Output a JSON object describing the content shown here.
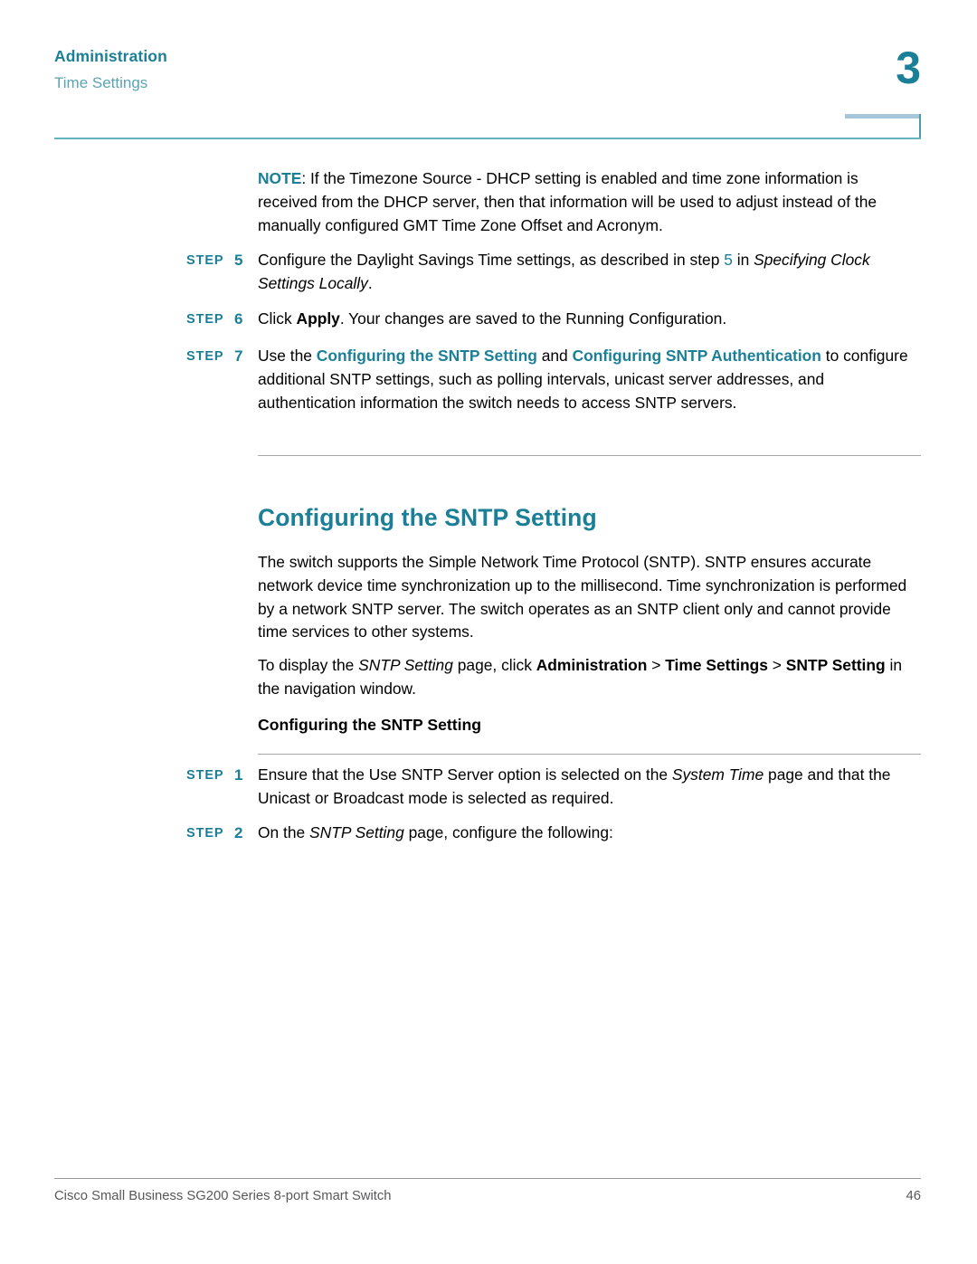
{
  "header": {
    "chapter_title": "Administration",
    "section_title": "Time Settings",
    "chapter_number": "3"
  },
  "note": {
    "label": "NOTE",
    "text": ": If the Timezone Source - DHCP setting is enabled and time zone information is received from the DHCP server, then that information will be used to adjust instead of the manually configured GMT Time Zone Offset and Acronym."
  },
  "steps_group_one": [
    {
      "label": "STEP",
      "number": "5",
      "parts": [
        {
          "text": "Configure the Daylight Savings Time settings, as described in step ",
          "style": "plain"
        },
        {
          "text": "5",
          "style": "teal"
        },
        {
          "text": " in ",
          "style": "plain"
        },
        {
          "text": "Specifying Clock Settings Locally",
          "style": "italic"
        },
        {
          "text": ".",
          "style": "plain"
        }
      ]
    },
    {
      "label": "STEP",
      "number": "6",
      "parts": [
        {
          "text": "Click ",
          "style": "plain"
        },
        {
          "text": "Apply",
          "style": "bold"
        },
        {
          "text": ". Your changes are saved to the Running Configuration.",
          "style": "plain"
        }
      ]
    },
    {
      "label": "STEP",
      "number": "7",
      "parts": [
        {
          "text": "Use the ",
          "style": "plain"
        },
        {
          "text": "Configuring the SNTP Setting",
          "style": "teal-bold"
        },
        {
          "text": " and ",
          "style": "plain"
        },
        {
          "text": "Configuring SNTP Authentication",
          "style": "teal-bold"
        },
        {
          "text": " to configure additional SNTP settings, such as polling intervals, unicast server addresses, and authentication information the switch needs to access SNTP servers.",
          "style": "plain"
        }
      ]
    }
  ],
  "section": {
    "heading": "Configuring the SNTP Setting",
    "intro_paragraph": "The switch supports the Simple Network Time Protocol (SNTP). SNTP ensures accurate network device time synchronization up to the millisecond. Time synchronization is performed by a network SNTP server. The switch operates as an SNTP client only and cannot provide time services to other systems.",
    "nav_paragraph_parts": [
      {
        "text": "To display the ",
        "style": "plain"
      },
      {
        "text": "SNTP Setting",
        "style": "italic"
      },
      {
        "text": " page, click ",
        "style": "plain"
      },
      {
        "text": "Administration",
        "style": "bold"
      },
      {
        "text": " > ",
        "style": "plain"
      },
      {
        "text": "Time Settings",
        "style": "bold"
      },
      {
        "text": " > ",
        "style": "plain"
      },
      {
        "text": "SNTP Setting",
        "style": "bold"
      },
      {
        "text": " in the navigation window.",
        "style": "plain"
      }
    ],
    "sub_heading": "Configuring the SNTP Setting"
  },
  "steps_group_two": [
    {
      "label": "STEP",
      "number": "1",
      "parts": [
        {
          "text": "Ensure that the Use SNTP Server option is selected on the ",
          "style": "plain"
        },
        {
          "text": "System Time",
          "style": "italic"
        },
        {
          "text": " page and that the Unicast or Broadcast mode is selected as required.",
          "style": "plain"
        }
      ]
    },
    {
      "label": "STEP",
      "number": "2",
      "parts": [
        {
          "text": "On the ",
          "style": "plain"
        },
        {
          "text": "SNTP Setting",
          "style": "italic"
        },
        {
          "text": " page, configure the following:",
          "style": "plain"
        }
      ]
    }
  ],
  "footer": {
    "product": "Cisco Small Business SG200 Series 8-port Smart Switch",
    "page_number": "46"
  },
  "colors": {
    "teal": "#1b7f97",
    "teal_light": "#5aa3b4",
    "rule_teal": "#67b2bf",
    "rule_gray": "#a6a6a6",
    "tab_blue": "#a8c6da",
    "footer_gray": "#58585a"
  }
}
